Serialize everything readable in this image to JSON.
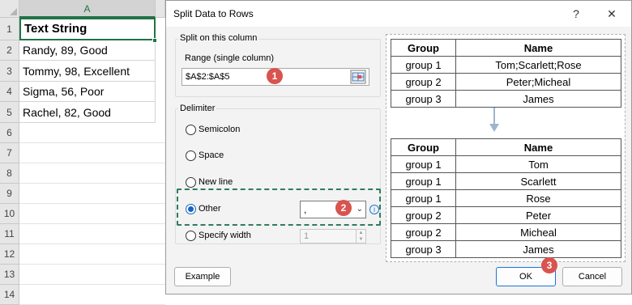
{
  "spreadsheet": {
    "column": "A",
    "rows": [
      {
        "num": "1",
        "text": "Text String"
      },
      {
        "num": "2",
        "text": "Randy, 89, Good"
      },
      {
        "num": "3",
        "text": "Tommy, 98, Excellent"
      },
      {
        "num": "4",
        "text": "Sigma, 56, Poor"
      },
      {
        "num": "5",
        "text": "Rachel, 82, Good"
      },
      {
        "num": "6",
        "text": ""
      },
      {
        "num": "7",
        "text": ""
      },
      {
        "num": "8",
        "text": ""
      },
      {
        "num": "9",
        "text": ""
      },
      {
        "num": "10",
        "text": ""
      },
      {
        "num": "11",
        "text": ""
      },
      {
        "num": "12",
        "text": ""
      },
      {
        "num": "13",
        "text": ""
      },
      {
        "num": "14",
        "text": ""
      }
    ]
  },
  "dialog": {
    "title": "Split Data to Rows",
    "help_label": "?",
    "close_label": "✕",
    "split_group_label": "Split on this column",
    "range_label": "Range (single column)",
    "range_value": "$A$2:$A$5",
    "delimiter_group_label": "Delimiter",
    "options": {
      "semicolon": "Semicolon",
      "space": "Space",
      "new_line": "New line",
      "other": "Other",
      "specify_width": "Specify width"
    },
    "selected_option": "other",
    "other_value": ",",
    "width_value": "1",
    "info_label": "i",
    "example_label": "Example",
    "ok_label": "OK",
    "cancel_label": "Cancel",
    "badges": {
      "one": "1",
      "two": "2",
      "three": "3"
    }
  },
  "preview_before": {
    "headers": [
      "Group",
      "Name"
    ],
    "rows": [
      [
        "group 1",
        "Tom;Scarlett;Rose"
      ],
      [
        "group 2",
        "Peter;Micheal"
      ],
      [
        "group 3",
        "James"
      ]
    ]
  },
  "preview_after": {
    "headers": [
      "Group",
      "Name"
    ],
    "rows": [
      [
        "group 1",
        "Tom"
      ],
      [
        "group 1",
        "Scarlett"
      ],
      [
        "group 1",
        "Rose"
      ],
      [
        "group 2",
        "Peter"
      ],
      [
        "group 2",
        "Micheal"
      ],
      [
        "group 3",
        "James"
      ]
    ]
  },
  "colors": {
    "excel_green": "#217346",
    "badge_red": "#d9534f",
    "radio_blue": "#1565c0",
    "dashed_green": "#2e7d5b"
  }
}
